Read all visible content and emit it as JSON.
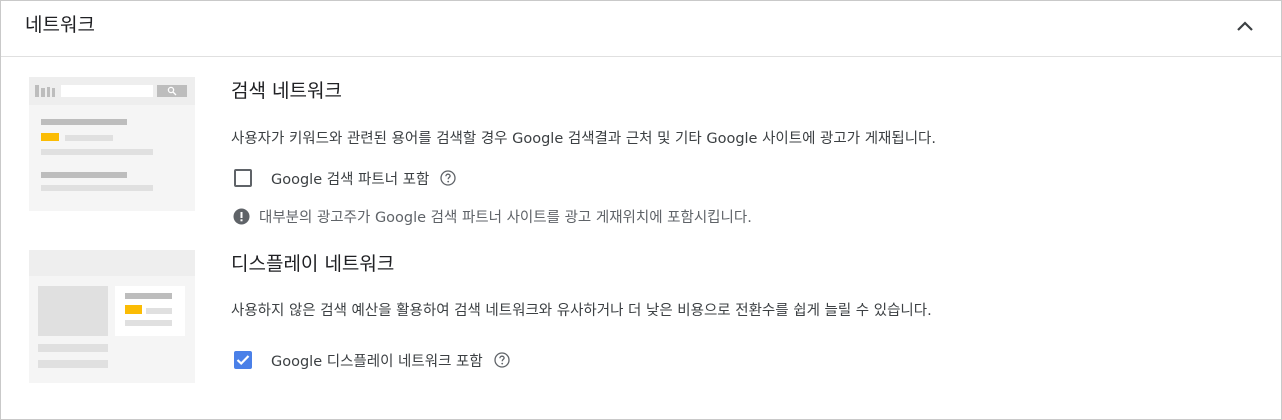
{
  "header": {
    "title": "네트워크"
  },
  "search_network": {
    "title": "검색 네트워크",
    "description": "사용자가 키워드와 관련된 용어를 검색할 경우 Google 검색결과 근처 및 기타 Google 사이트에 광고가 게재됩니다.",
    "checkbox_label": "Google 검색 파트너 포함",
    "checked": false,
    "info_text": "대부분의 광고주가 Google 검색 파트너 사이트를 광고 게재위치에 포함시킵니다."
  },
  "display_network": {
    "title": "디스플레이 네트워크",
    "description": "사용하지 않은 검색 예산을 활용하여 검색 네트워크와 유사하거나 더 낮은 비용으로 전환수를 쉽게 늘릴 수 있습니다.",
    "checkbox_label": "Google 디스플레이 네트워크 포함",
    "checked": true
  },
  "colors": {
    "accent": "#4a80e8",
    "ad_highlight": "#fbbc04"
  }
}
